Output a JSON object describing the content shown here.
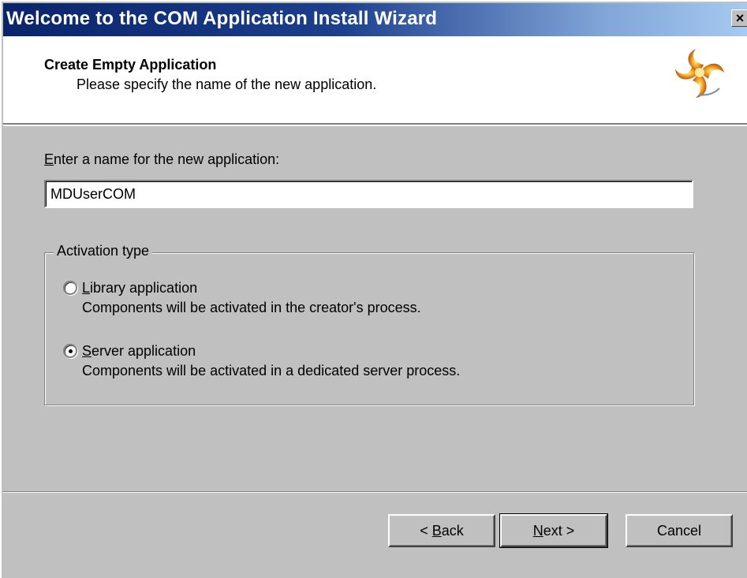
{
  "window": {
    "title": "Welcome to the COM Application Install Wizard",
    "close_glyph": "×"
  },
  "header": {
    "title": "Create Empty Application",
    "subtitle": "Please specify the name of the new application.",
    "logo_icon": "wizard-spiral-logo-icon"
  },
  "name_field": {
    "label_accel": "E",
    "label_rest": "nter a name for the new application:",
    "value": "MDUserCOM"
  },
  "activation": {
    "legend": "Activation type",
    "options": [
      {
        "label_accel": "L",
        "label_rest": "ibrary application",
        "description": "Components will be activated in the creator's process.",
        "selected": false
      },
      {
        "label_accel": "S",
        "label_rest": "erver application",
        "description": "Components will be activated in a dedicated server process.",
        "selected": true
      }
    ]
  },
  "buttons": {
    "back_prefix": "< ",
    "back_accel": "B",
    "back_rest": "ack",
    "next_accel": "N",
    "next_rest": "ext >",
    "cancel": "Cancel"
  },
  "colors": {
    "titlebar_start": "#0a246a",
    "titlebar_end": "#a6caf0",
    "face": "#c0c0c0"
  }
}
